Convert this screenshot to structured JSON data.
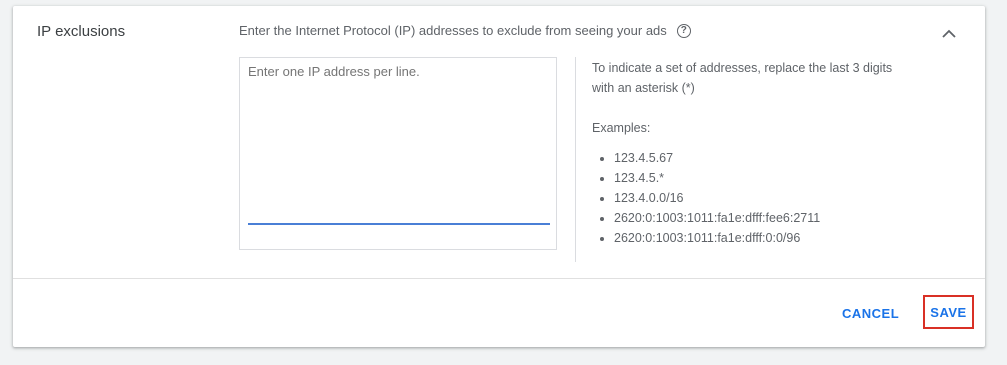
{
  "section": {
    "title": "IP exclusions",
    "description": "Enter the Internet Protocol (IP) addresses to exclude from seeing your ads",
    "help_icon_glyph": "?"
  },
  "input": {
    "placeholder": "Enter one IP address per line.",
    "value": ""
  },
  "help_panel": {
    "instruction_line1": "To indicate a set of addresses, replace the last 3 digits",
    "instruction_line2": "with an asterisk (*)",
    "examples_label": "Examples:",
    "examples": [
      "123.4.5.67",
      "123.4.5.*",
      "123.4.0.0/16",
      "2620:0:1003:1011:fa1e:dfff:fee6:2711",
      "2620:0:1003:1011:fa1e:dfff:0:0/96"
    ]
  },
  "actions": {
    "cancel_label": "CANCEL",
    "save_label": "SAVE"
  },
  "colors": {
    "accent": "#1a73e8",
    "highlight_border": "#d93025",
    "underline": "#4a7fd6"
  }
}
